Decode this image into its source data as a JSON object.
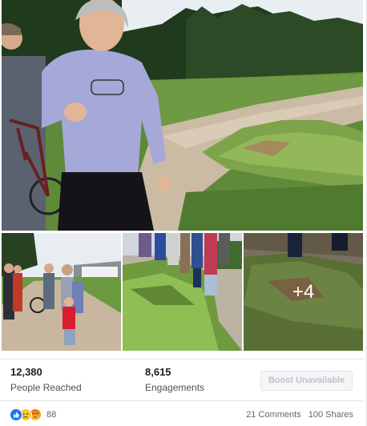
{
  "post": {
    "more_photos": "+4",
    "stats": {
      "people_reached_value": "12,380",
      "people_reached_label": "People Reached",
      "engagements_value": "8,615",
      "engagements_label": "Engagements"
    },
    "boost_button_label": "Boost Unavailable",
    "reactions": {
      "icons": [
        "like-icon",
        "sad-icon",
        "angry-icon"
      ],
      "count": "88"
    },
    "comments_label": "21 Comments",
    "shares_label": "100 Shares"
  },
  "colors": {
    "like_blue": "#1877f2",
    "emoji_yellow": "#fcc93b",
    "angry_red": "#e9710f",
    "muted_text": "#606770"
  }
}
